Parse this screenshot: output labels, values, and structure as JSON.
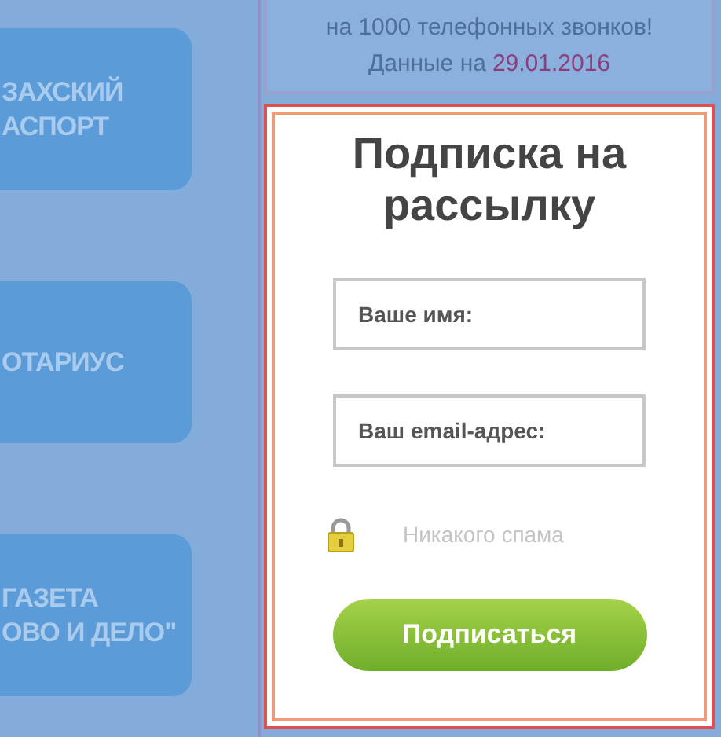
{
  "menu_buttons": [
    {
      "lines": [
        "ЗАХСКИЙ",
        "АСПОРТ"
      ]
    },
    {
      "lines": [
        "ОТАРИУС"
      ]
    },
    {
      "lines": [
        "ГАЗЕТА",
        "ОВО И ДЕЛО\""
      ]
    }
  ],
  "info": {
    "text": "на 1000 телефонных звонков!",
    "date_label": "Данные на",
    "date": "29.01.2016"
  },
  "subscribe": {
    "title": "Подписка на рассылку",
    "fields": [
      {
        "placeholder": "Ваше имя:"
      },
      {
        "placeholder": "Ваш email-адрес:"
      }
    ],
    "note": "Никакого спама",
    "button": "Подписаться"
  }
}
